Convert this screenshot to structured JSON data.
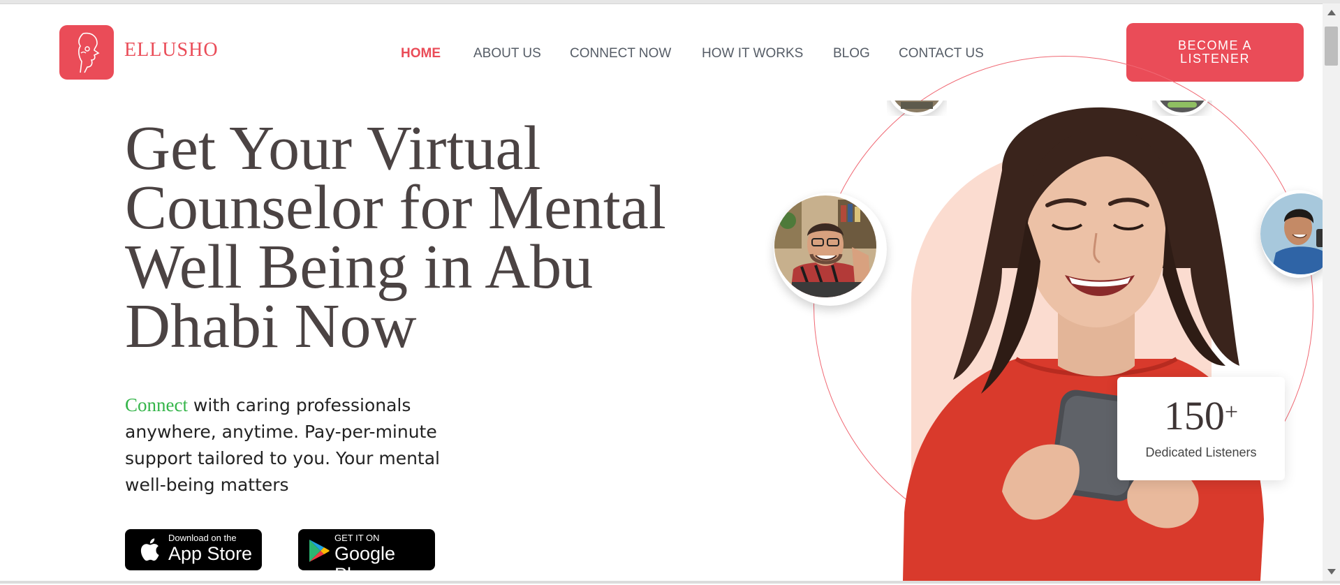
{
  "brand": {
    "name": "ELLUSHO",
    "accent_color": "#ea4c58",
    "logo_icon": "face-profile-logo-icon"
  },
  "nav": {
    "items": [
      {
        "label": "HOME",
        "active": true
      },
      {
        "label": "ABOUT US",
        "active": false
      },
      {
        "label": "CONNECT NOW",
        "active": false
      },
      {
        "label": "HOW IT WORKS",
        "active": false
      },
      {
        "label": "BLOG",
        "active": false
      },
      {
        "label": "CONTACT US",
        "active": false
      }
    ],
    "cta": {
      "line1": "BECOME A",
      "line2": "LISTENER"
    }
  },
  "hero": {
    "headline": [
      "Get Your Virtual",
      "Counselor for Mental",
      "Well Being in Abu",
      "Dhabi Now"
    ],
    "subtext_accent": "Connect",
    "subtext_rest": " with caring professionals anywhere, anytime. Pay-per-minute support tailored to you. Your mental well-being matters",
    "accent_green": "#35b54a"
  },
  "store_buttons": {
    "app_store": {
      "small": "Download on the",
      "big": "App Store",
      "icon": "apple-icon"
    },
    "google_play": {
      "small": "GET IT ON",
      "big": "Google Play",
      "icon": "google-play-icon"
    }
  },
  "stat": {
    "value": "150",
    "suffix": "+",
    "label": "Dedicated Listeners"
  }
}
